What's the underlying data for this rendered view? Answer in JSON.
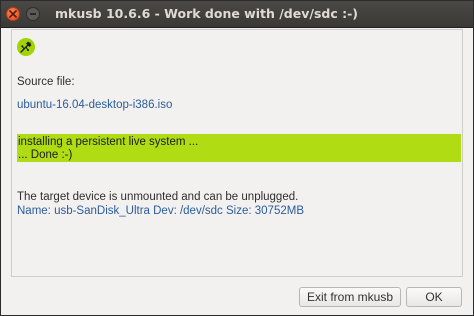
{
  "window": {
    "title": "mkusb 10.6.6 - Work done with /dev/sdc :-)"
  },
  "icons": {
    "close": "close-icon",
    "minimize": "minimize-icon",
    "app": "usb-icon"
  },
  "colors": {
    "status_band": "#b0dc14",
    "link_text": "#2b5d9a",
    "titlebar": "#3c3b37"
  },
  "content": {
    "source_label": "Source file:",
    "source_file": "ubuntu-16.04-desktop-i386.iso",
    "status_line_1": "installing a persistent live system ...",
    "status_line_2": "... Done :-)",
    "unplug_message": "The target device is unmounted and can be unplugged.",
    "device_info": "Name: usb-SanDisk_Ultra Dev: /dev/sdc Size: 30752MB"
  },
  "buttons": {
    "exit_label": "Exit from mkusb",
    "ok_label": "OK"
  }
}
